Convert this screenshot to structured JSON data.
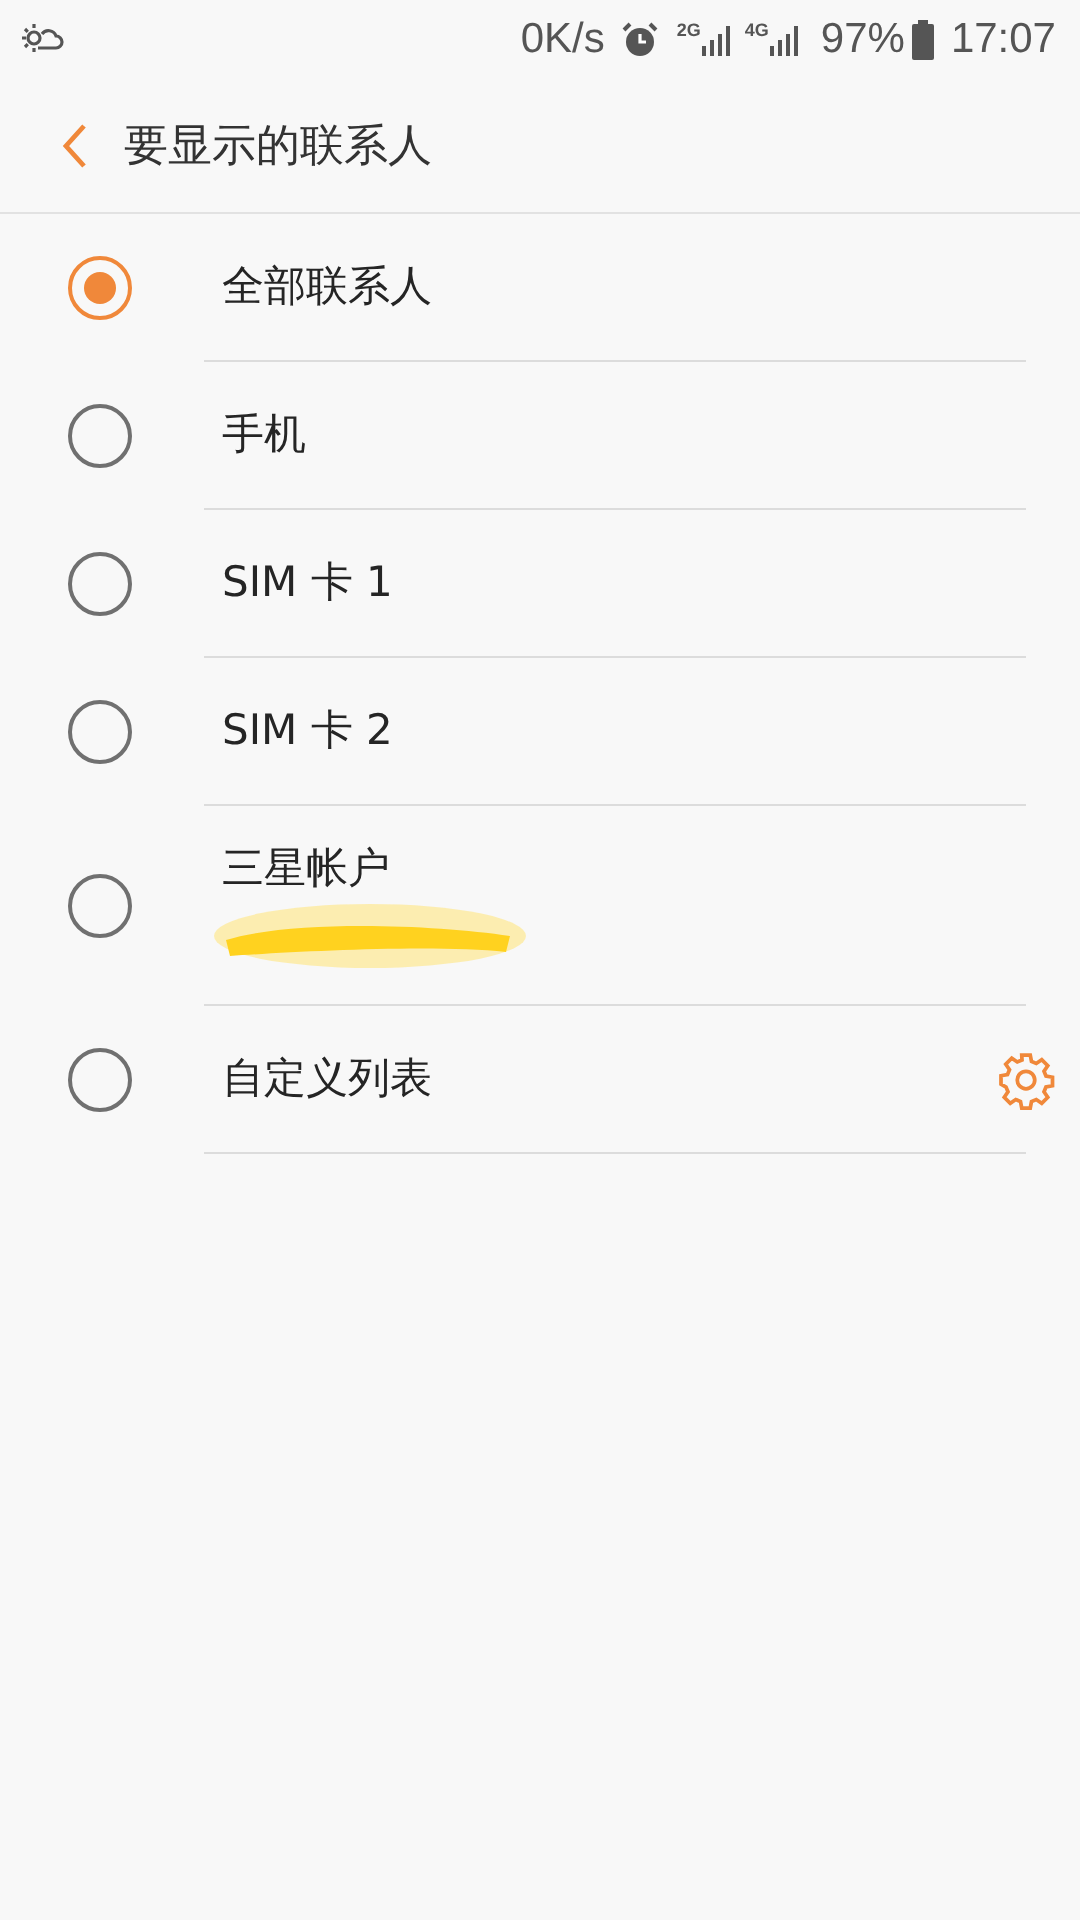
{
  "status_bar": {
    "speed": "0K/s",
    "sim1_label": "2G",
    "sim2_label": "4G",
    "battery": "97%",
    "time": "17:07"
  },
  "header": {
    "title": "要显示的联系人"
  },
  "options": [
    {
      "kind": "plain",
      "label": "全部联系人",
      "selected": true
    },
    {
      "kind": "plain",
      "label": "手机",
      "selected": false
    },
    {
      "kind": "plain",
      "label": "SIM 卡 1",
      "selected": false
    },
    {
      "kind": "plain",
      "label": "SIM 卡 2",
      "selected": false
    },
    {
      "kind": "account",
      "label": "三星帐户",
      "selected": false
    },
    {
      "kind": "settings",
      "label": "自定义列表",
      "selected": false
    }
  ]
}
